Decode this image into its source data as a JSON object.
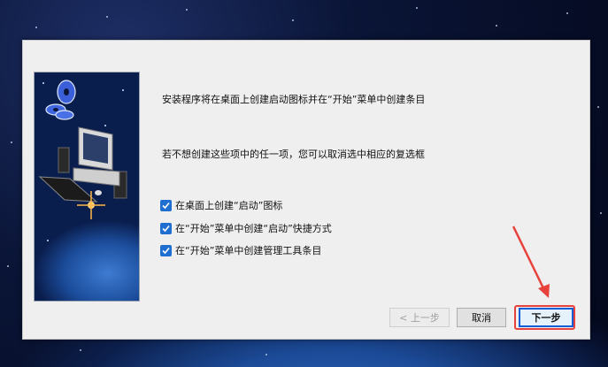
{
  "dialog": {
    "message_line1": "安装程序将在桌面上创建启动图标并在“开始”菜单中创建条目",
    "message_line2": "若不想创建这些项中的任一项，您可以取消选中相应的复选框",
    "options": [
      {
        "label": "在桌面上创建“启动”图标",
        "checked": true
      },
      {
        "label": "在“开始”菜单中创建“启动”快捷方式",
        "checked": true
      },
      {
        "label": "在“开始”菜单中创建管理工具条目",
        "checked": true
      }
    ],
    "buttons": {
      "back": "< 上一步",
      "cancel": "取消",
      "next": "下一步"
    }
  },
  "colors": {
    "checkbox": "#1f6fd1",
    "annotation": "#e8413c"
  },
  "icons": {
    "side_image": "computer-with-cds-illustration",
    "annotation_arrow": "red-arrow-icon"
  }
}
